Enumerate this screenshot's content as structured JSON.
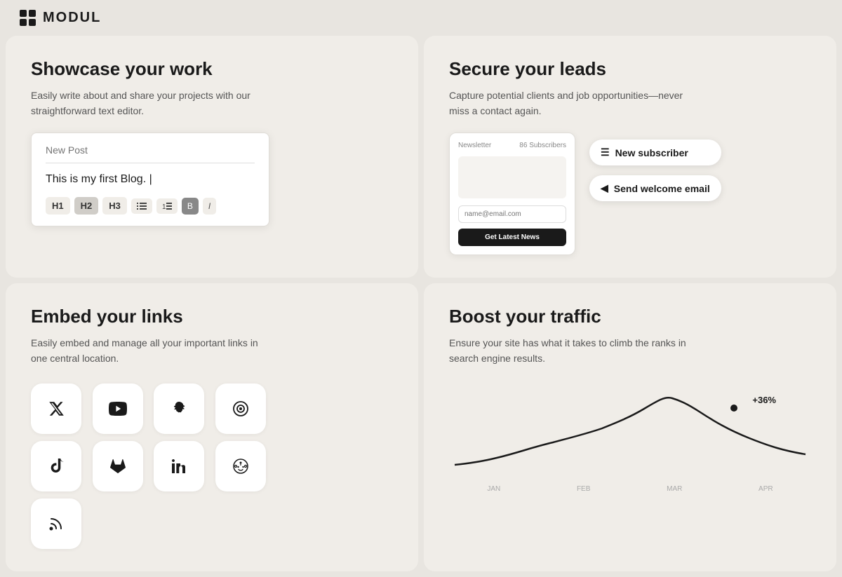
{
  "header": {
    "logo_text": "MODUL",
    "logo_icon": "grid-icon"
  },
  "cards": {
    "showcase": {
      "title": "Showcase your work",
      "description": "Easily write about and share your projects with our straightforward text editor.",
      "editor": {
        "placeholder": "New Post",
        "content": "This is my first Blog. |",
        "toolbar": {
          "h1": "H1",
          "h2": "H2",
          "h3": "H3",
          "list": "list-icon",
          "ordered": "ordered-list-icon",
          "bold": "B",
          "italic": "I"
        }
      }
    },
    "leads": {
      "title": "Secure your leads",
      "description": "Capture potential clients and job opportunities—never miss a contact again.",
      "newsletter": {
        "label": "Newsletter",
        "subscribers": "86 Subscribers",
        "email_placeholder": "name@email.com",
        "cta": "Get Latest News"
      },
      "badge_subscriber": "New subscriber",
      "badge_email": "Send welcome email"
    },
    "links": {
      "title": "Embed your links",
      "description": "Easily embed and manage all your important links in one central location.",
      "social_icons": [
        {
          "name": "x-twitter",
          "symbol": "✕"
        },
        {
          "name": "youtube",
          "symbol": "▶"
        },
        {
          "name": "snapchat",
          "symbol": "👻"
        },
        {
          "name": "camera",
          "symbol": "⊙"
        },
        {
          "name": "tiktok",
          "symbol": "♪"
        },
        {
          "name": "gitlab",
          "symbol": "🦊"
        },
        {
          "name": "linkedin",
          "symbol": "in"
        },
        {
          "name": "reddit",
          "symbol": "👽"
        },
        {
          "name": "rss",
          "symbol": "⌘"
        }
      ]
    },
    "traffic": {
      "title": "Boost your traffic",
      "description": "Ensure your site has what it takes to climb the ranks in search engine results.",
      "chart": {
        "label": "+36%",
        "months": [
          "JAN",
          "FEB",
          "MAR",
          "APR"
        ]
      }
    }
  }
}
